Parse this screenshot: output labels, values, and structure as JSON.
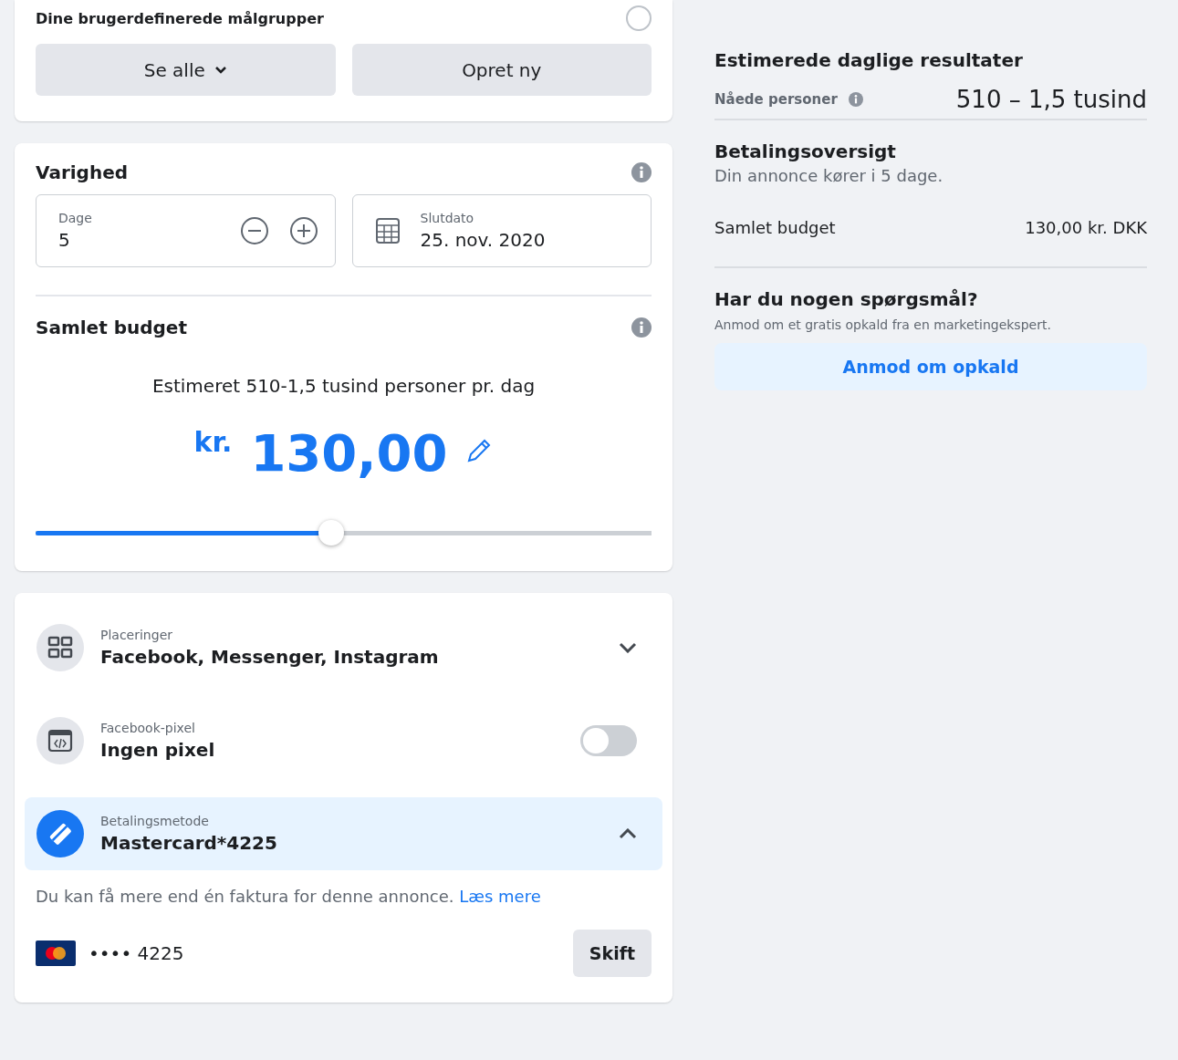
{
  "audience_card": {
    "option": {
      "label": "Dine brugerdefinerede målgrupper",
      "selected": false
    },
    "buttons": [
      {
        "label": "Se alle",
        "kind": "dropdown"
      },
      {
        "label": "Opret ny",
        "kind": "plain"
      }
    ]
  },
  "duration": {
    "title": "Varighed",
    "days": {
      "label": "Dage",
      "value": "5"
    },
    "end_date": {
      "label": "Slutdato",
      "value": "25. nov. 2020"
    }
  },
  "budget": {
    "title": "Samlet budget",
    "estimate": "Estimeret 510-1,5 tusind personer pr. dag",
    "currency": "kr.",
    "amount": "130,00",
    "level": 0.48
  },
  "settings": [
    {
      "kind": "placements",
      "label": "Placeringer",
      "value": "Facebook, Messenger, Instagram",
      "expanded": false
    },
    {
      "kind": "pixel",
      "label": "Facebook-pixel",
      "value": "Ingen pixel",
      "on": false
    },
    {
      "kind": "payment",
      "label": "Betalingsmetode",
      "value": "Mastercard*4225",
      "expanded": true
    }
  ],
  "payment_details": {
    "note": "Du kan få mere end én faktura for denne annonce.",
    "link": "Læs mere",
    "card_number": "•••• 4225",
    "change_button": "Skift"
  },
  "results": {
    "title": "Estimerede daglige resultater",
    "reach_label": "Nåede personer",
    "reach_value": "510 – 1,5 tusind"
  },
  "payment_summary": {
    "title": "Betalingsoversigt",
    "subtitle": "Din annonce kører i 5 dage.",
    "budget_label": "Samlet budget",
    "budget_value": "130,00 kr. DKK"
  },
  "help": {
    "title": "Har du nogen spørgsmål?",
    "text": "Anmod om et gratis opkald fra en marketingekspert.",
    "button": "Anmod om opkald"
  }
}
